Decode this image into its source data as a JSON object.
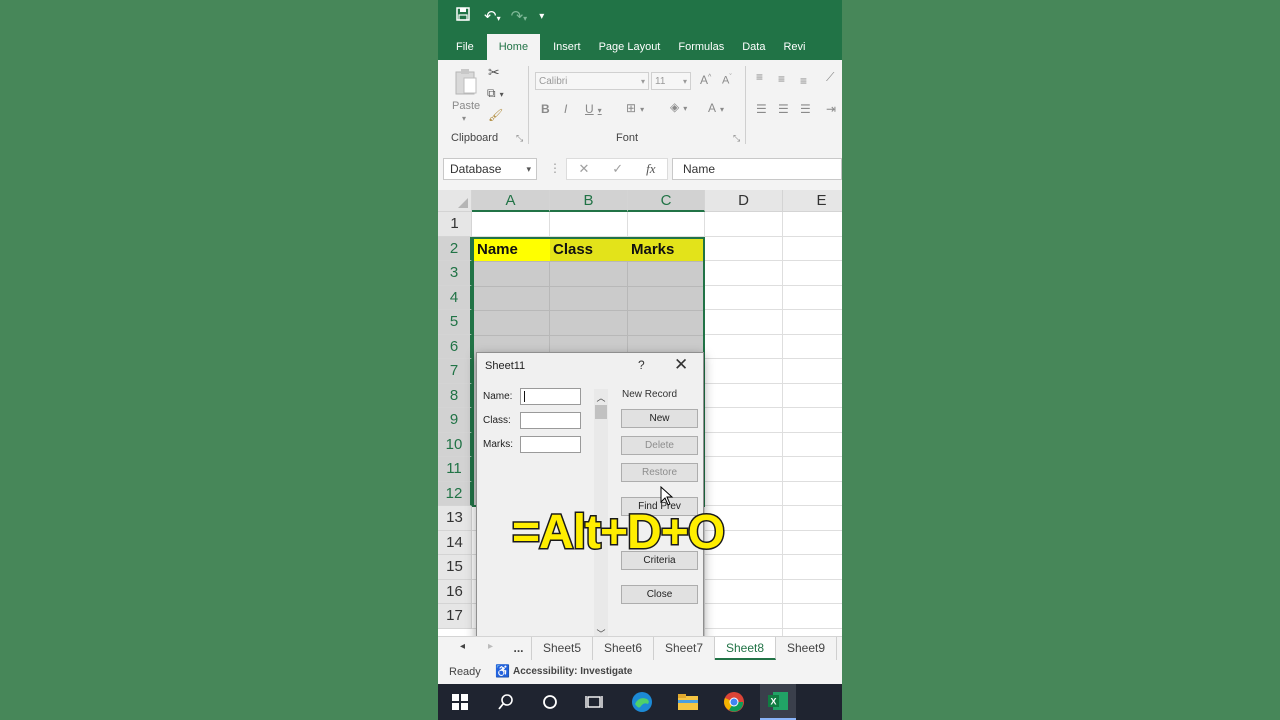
{
  "tabs": [
    "File",
    "Home",
    "Insert",
    "Page Layout",
    "Formulas",
    "Data",
    "Revi"
  ],
  "ribbon": {
    "paste_label": "Paste",
    "clipboard_label": "Clipboard",
    "font_label": "Font",
    "font_name": "Calibri",
    "font_size": "11"
  },
  "formula_bar": {
    "name_box": "Database",
    "fx": "fx",
    "content": "Name"
  },
  "sheet": {
    "columns": [
      "A",
      "B",
      "C",
      "D",
      "E"
    ],
    "rows": [
      "1",
      "2",
      "3",
      "4",
      "5",
      "6",
      "7",
      "8",
      "9",
      "10",
      "11",
      "12",
      "13",
      "14",
      "15",
      "16",
      "17"
    ],
    "headers": [
      "Name",
      "Class",
      "Marks"
    ]
  },
  "dialog": {
    "title": "Sheet11",
    "help": "?",
    "close": "✕",
    "fields": [
      "Name:",
      "Class:",
      "Marks:"
    ],
    "record_status": "New Record",
    "buttons": {
      "new": "New",
      "delete": "Delete",
      "restore": "Restore",
      "find_prev": "Find Prev",
      "criteria": "Criteria",
      "close": "Close"
    }
  },
  "sheet_tabs": {
    "more": "...",
    "tabs": [
      "Sheet5",
      "Sheet6",
      "Sheet7",
      "Sheet8",
      "Sheet9"
    ]
  },
  "status": {
    "ready": "Ready",
    "accessibility": "Accessibility: Investigate"
  },
  "overlay_text": "=Alt+D+O",
  "colors": {
    "excel_green": "#217346",
    "header_yellow": "#ffff00",
    "overlay_yellow": "#ffee00",
    "background": "#478759"
  }
}
